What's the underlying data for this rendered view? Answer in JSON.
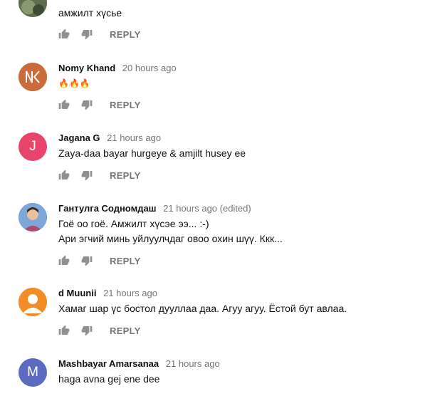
{
  "comments": [
    {
      "author": "",
      "time": "",
      "text_lines": [
        "амжилт хүсье"
      ],
      "avatar_initials": "",
      "avatar_color": "#6a7b5a",
      "reply_label": "REPLY"
    },
    {
      "author": "Nomy Khand",
      "time": "20 hours ago",
      "text_lines": [
        "🔥🔥🔥"
      ],
      "avatar_initials": "NK",
      "avatar_color": "#c96b3a",
      "reply_label": "REPLY"
    },
    {
      "author": "Jagana G",
      "time": "21 hours ago",
      "text_lines": [
        "Zaya-daa bayar hurgeye &  amjilt husey ee"
      ],
      "avatar_initials": "J",
      "avatar_color": "#e8456c",
      "reply_label": "REPLY"
    },
    {
      "author": "Гантулга Содномдаш",
      "time": "21 hours ago (edited)",
      "text_lines": [
        "Гоё оо гоё. Амжилт хүсэе ээ... :-)",
        "Ари эгчий минь уйлуулчдаг овоо охин шүү. Ккк..."
      ],
      "avatar_initials": "",
      "avatar_color": "#4a78b8",
      "reply_label": "REPLY"
    },
    {
      "author": "d Muunii",
      "time": "21 hours ago",
      "text_lines": [
        "Хамаг шар үс бостол дууллаа даа. Агуу агуу. Ёстой бут авлаа."
      ],
      "avatar_initials": "",
      "avatar_color": "#f28b28",
      "reply_label": "REPLY"
    },
    {
      "author": "Mashbayar Amarsanaa",
      "time": "21 hours ago",
      "text_lines": [
        "haga avna gej ene dee"
      ],
      "avatar_initials": "M",
      "avatar_color": "#5c6bc0",
      "reply_label": ""
    }
  ]
}
